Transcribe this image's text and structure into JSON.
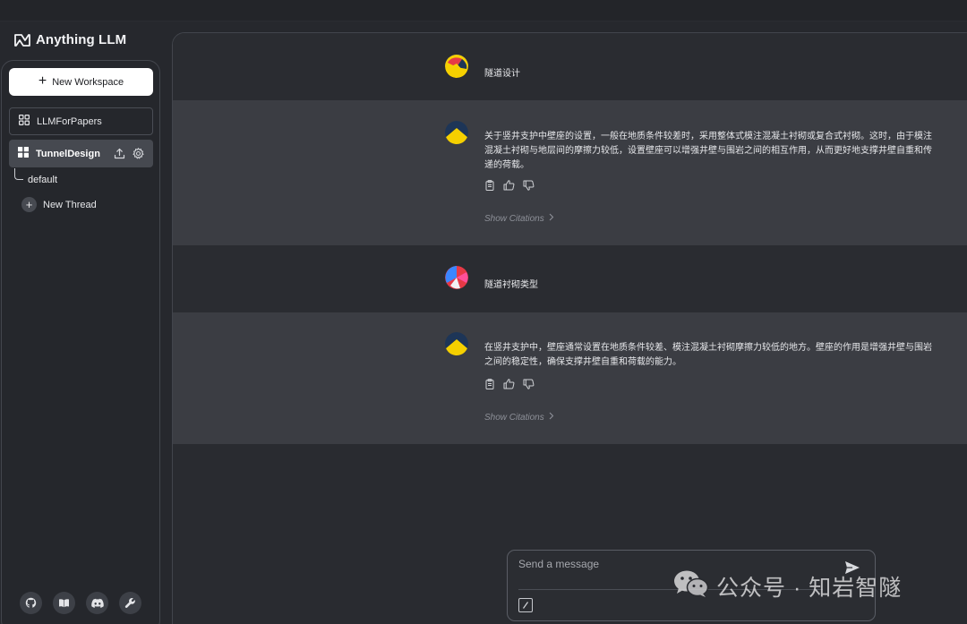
{
  "app": {
    "name": "Anything LLM"
  },
  "sidebar": {
    "new_workspace_label": "New Workspace",
    "workspaces": [
      {
        "name": "LLMForPapers",
        "active": false
      },
      {
        "name": "TunnelDesign",
        "active": true
      }
    ],
    "threads": [
      {
        "name": "default"
      }
    ],
    "new_thread_label": "New Thread",
    "footer_icons": [
      "github-icon",
      "docs-book-icon",
      "discord-icon",
      "wrench-icon"
    ]
  },
  "chat": {
    "messages": [
      {
        "role": "user",
        "text": "隧道设计"
      },
      {
        "role": "assistant",
        "text": "关于竖井支护中壁座的设置，一般在地质条件较差时，采用整体式模注混凝土衬砌或复合式衬砌。这时，由于模注混凝土衬砌与地层间的摩擦力较低，设置壁座可以增强井壁与围岩之间的相互作用，从而更好地支撑井壁自重和传递的荷载。",
        "citations_label": "Show Citations"
      },
      {
        "role": "user",
        "text": "隧道衬砌类型"
      },
      {
        "role": "assistant",
        "text": "在竖井支护中，壁座通常设置在地质条件较差、模注混凝土衬砌摩擦力较低的地方。壁座的作用是增强井壁与围岩之间的稳定性，确保支撑井壁自重和荷载的能力。",
        "citations_label": "Show Citations"
      }
    ]
  },
  "composer": {
    "placeholder": "Send a message"
  },
  "watermark": {
    "text": "公众号 · 知岩智隧"
  },
  "colors": {
    "background": "#26282d",
    "panel": "#292b30",
    "assistant_row": "#3b3d43",
    "accent_yellow": "#f5d000",
    "accent_navy": "#1d3557"
  }
}
